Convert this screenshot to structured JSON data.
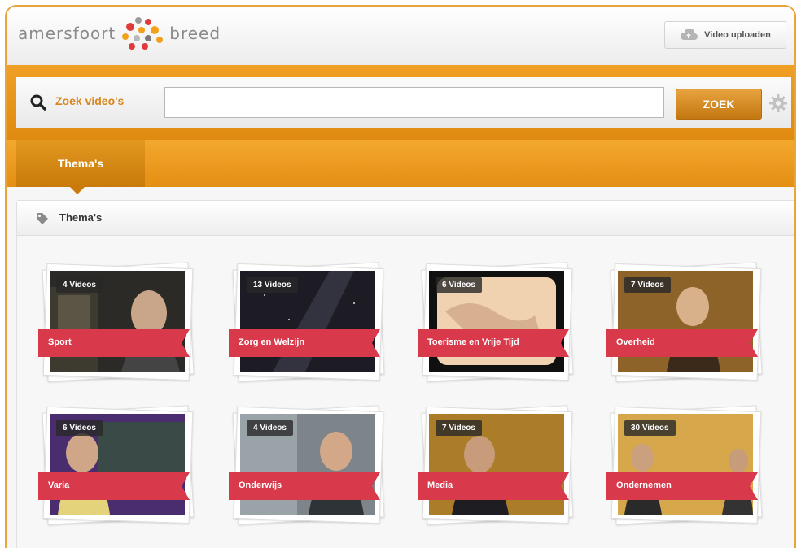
{
  "header": {
    "logo_left": "amersfoort",
    "logo_right": "breed",
    "upload_label": "Video uploaden"
  },
  "search": {
    "label": "Zoek video's",
    "value": "",
    "placeholder": "",
    "button_label": "ZOEK"
  },
  "tabs": [
    {
      "label": "Thema's"
    }
  ],
  "panel": {
    "title": "Thema's"
  },
  "colors": {
    "accent_orange": "#e8a53b",
    "ribbon_red": "#d8394b"
  },
  "themes": [
    {
      "name": "Sport",
      "count_label": "4 Videos"
    },
    {
      "name": "Zorg en Welzijn",
      "count_label": "13 Videos"
    },
    {
      "name": "Toerisme en Vrije Tijd",
      "count_label": "6 Videos"
    },
    {
      "name": "Overheid",
      "count_label": "7 Videos"
    },
    {
      "name": "Varia",
      "count_label": "6 Videos"
    },
    {
      "name": "Onderwijs",
      "count_label": "4 Videos"
    },
    {
      "name": "Media",
      "count_label": "7 Videos"
    },
    {
      "name": "Ondernemen",
      "count_label": "30 Videos"
    }
  ]
}
